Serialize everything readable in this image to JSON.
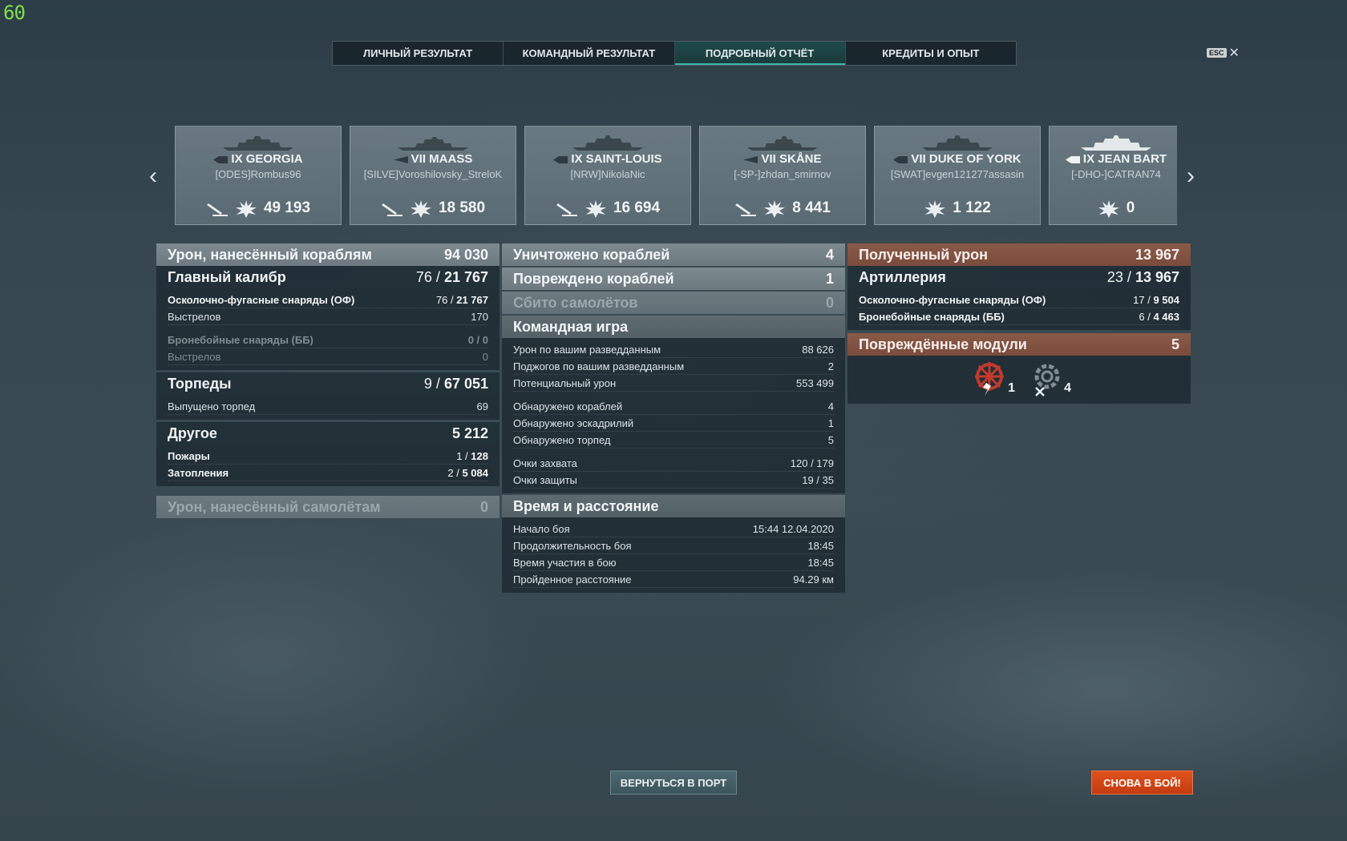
{
  "fps": "60",
  "tabs": [
    "ЛИЧНЫЙ РЕЗУЛЬТАТ",
    "КОМАНДНЫЙ РЕЗУЛЬТАТ",
    "ПОДРОБНЫЙ ОТЧЁТ",
    "КРЕДИТЫ И ОПЫТ"
  ],
  "active_tab": "ПОДРОБНЫЙ ОТЧЁТ",
  "close": {
    "key": "ESC",
    "icon": "close-icon"
  },
  "ships": [
    {
      "name": "IX GEORGIA",
      "player": "[ODES]Rombus96",
      "damage": "49 193",
      "torpedo_icon": true
    },
    {
      "name": "VII MAASS",
      "player": "[SILVE]Voroshilovsky_StreloK",
      "damage": "18 580",
      "torpedo_icon": true
    },
    {
      "name": "IX SAINT-LOUIS",
      "player": "[NRW]NikolaNic",
      "damage": "16 694",
      "torpedo_icon": true
    },
    {
      "name": "VII SKÅNE",
      "player": "[-SP-]zhdan_smirnov",
      "damage": "8 441",
      "torpedo_icon": true
    },
    {
      "name": "VII DUKE OF YORK",
      "player": "[SWAT]evgen121277assasin",
      "damage": "1 122",
      "torpedo_icon": false
    },
    {
      "name": "IX JEAN BART",
      "player": "[-DHO-]CATRAN74",
      "damage": "0",
      "torpedo_icon": false
    }
  ],
  "left": {
    "damage_title": "Урон, нанесённый кораблям",
    "damage_total": "94 030",
    "main_title": "Главный калибр",
    "main_hits": "76 / ",
    "main_dmg": "21 767",
    "he_label": "Осколочно-фугасные снаряды (ОФ)",
    "he_hits": "76 / ",
    "he_dmg": "21 767",
    "he_shots_label": "Выстрелов",
    "he_shots": "170",
    "ap_label": "Бронебойные снаряды (ББ)",
    "ap_val": "0 / 0",
    "ap_shots_label": "Выстрелов",
    "ap_shots": "0",
    "torp_title": "Торпеды",
    "torp_hits": "9 / ",
    "torp_dmg": "67 051",
    "torp_launched_label": "Выпущено торпед",
    "torp_launched": "69",
    "other_title": "Другое",
    "other_total": "5 212",
    "fires_label": "Пожары",
    "fires_hits": "1 / ",
    "fires_dmg": "128",
    "floods_label": "Затопления",
    "floods_hits": "2 / ",
    "floods_dmg": "5 084",
    "planes_title": "Урон, нанесённый самолётам",
    "planes_val": "0"
  },
  "mid": {
    "destroyed_label": "Уничтожено кораблей",
    "destroyed": "4",
    "damaged_label": "Повреждено кораблей",
    "damaged": "1",
    "planes_label": "Сбито самолётов",
    "planes": "0",
    "team_title": "Командная игра",
    "team_rows1": [
      {
        "label": "Урон по вашим разведданным",
        "value": "88 626"
      },
      {
        "label": "Поджогов по вашим разведданным",
        "value": "2"
      },
      {
        "label": "Потенциальный урон",
        "value": "553 499"
      }
    ],
    "team_rows2": [
      {
        "label": "Обнаружено кораблей",
        "value": "4"
      },
      {
        "label": "Обнаружено эскадрилий",
        "value": "1"
      },
      {
        "label": "Обнаружено торпед",
        "value": "5"
      }
    ],
    "team_rows3": [
      {
        "label": "Очки захвата",
        "value": "120 / 179"
      },
      {
        "label": "Очки защиты",
        "value": "19 / 35"
      }
    ],
    "time_title": "Время и расстояние",
    "time_rows": [
      {
        "label": "Начало боя",
        "value": "15:44  12.04.2020"
      },
      {
        "label": "Продолжительность боя",
        "value": "18:45"
      },
      {
        "label": "Время участия в бою",
        "value": "18:45"
      },
      {
        "label": "Пройденное расстояние",
        "value": "94.29 км"
      }
    ]
  },
  "right": {
    "received_title": "Полученный урон",
    "received_total": "13 967",
    "art_title": "Артиллерия",
    "art_hits": "23 / ",
    "art_dmg": "13 967",
    "he_label": "Осколочно-фугасные снаряды (ОФ)",
    "he_hits": "17 / ",
    "he_dmg": "9 504",
    "ap_label": "Бронебойные снаряды (ББ)",
    "ap_hits": "6 / ",
    "ap_dmg": "4 463",
    "modules_title": "Повреждённые модули",
    "modules_total": "5",
    "modules": [
      {
        "icon": "steering-gear-icon",
        "count": "1"
      },
      {
        "icon": "engine-icon",
        "count": "4"
      }
    ]
  },
  "buttons": {
    "port": "ВЕРНУТЬСЯ В ПОРТ",
    "battle": "СНОВА В БОЙ!"
  }
}
